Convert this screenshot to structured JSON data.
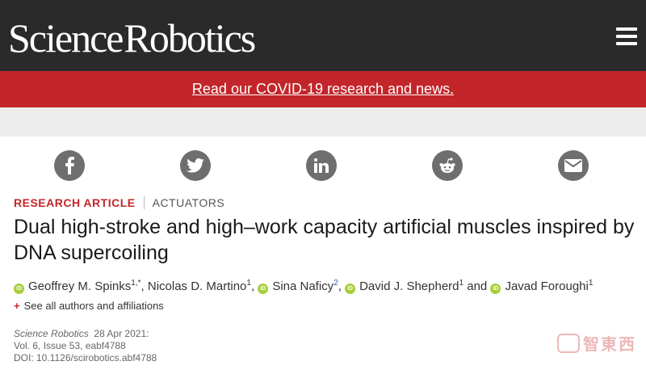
{
  "header": {
    "brand_word1": "Science",
    "brand_word2": "Robotics",
    "menu_icon": "hamburger-menu-icon",
    "background": "#2a2a2a"
  },
  "banner": {
    "text": "Read our COVID-19 research and news.",
    "background": "#c3262a"
  },
  "share": {
    "icons": [
      "facebook-icon",
      "twitter-icon",
      "linkedin-icon",
      "reddit-icon",
      "email-icon"
    ],
    "color": "#6e6e6e"
  },
  "article": {
    "type": "RESEARCH ARTICLE",
    "subject": "ACTUATORS",
    "title": "Dual high-stroke and high–work capacity artificial muscles inspired by DNA supercoiling",
    "authors": [
      {
        "name": "Geoffrey M. Spinks",
        "sup": "1,*",
        "orcid": true
      },
      {
        "name": "Nicolas D. Martino",
        "sup": "1",
        "orcid": false
      },
      {
        "name": "Sina Naficy",
        "sup": "2",
        "orcid": true
      },
      {
        "name": "David J. Shepherd",
        "sup": "1",
        "orcid": true
      },
      {
        "name": "Javad Foroughi",
        "sup": "1",
        "orcid": true
      }
    ],
    "separator": ",",
    "conjunction": "and",
    "see_all": "See all authors and affiliations",
    "accent": "#c3262a"
  },
  "citation": {
    "journal": "Science Robotics",
    "date": "28 Apr 2021:",
    "volume": "Vol. 6, Issue 53, eabf4788",
    "doi": "DOI: 10.1126/scirobotics.abf4788"
  },
  "watermark": {
    "text": "智東西"
  }
}
